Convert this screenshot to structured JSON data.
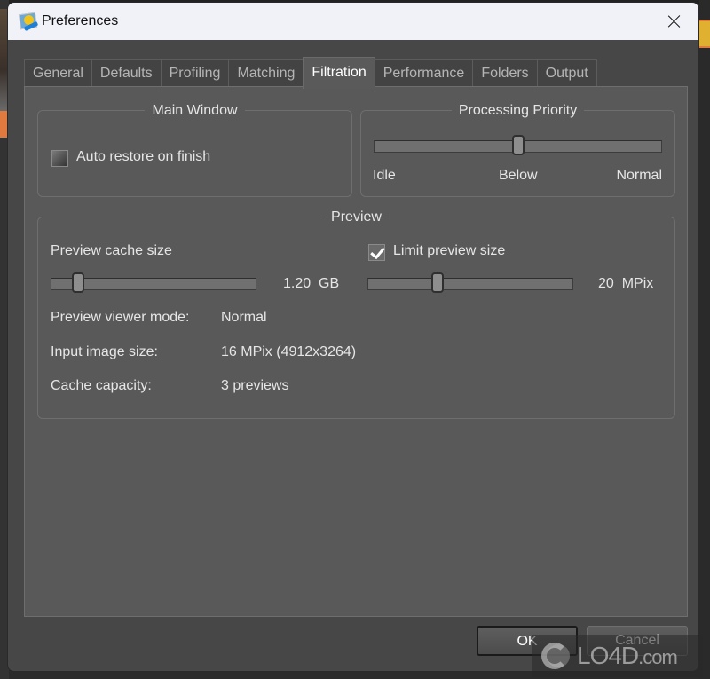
{
  "window": {
    "title": "Preferences",
    "app_icon": "image-editor-app-icon",
    "close_icon": "close-icon"
  },
  "tabs": [
    {
      "label": "General",
      "active": false
    },
    {
      "label": "Defaults",
      "active": false
    },
    {
      "label": "Profiling",
      "active": false
    },
    {
      "label": "Matching",
      "active": false
    },
    {
      "label": "Filtration",
      "active": true
    },
    {
      "label": "Performance",
      "active": false
    },
    {
      "label": "Folders",
      "active": false
    },
    {
      "label": "Output",
      "active": false
    }
  ],
  "main_window": {
    "title": "Main Window",
    "auto_restore": {
      "label": "Auto restore on finish",
      "checked": false
    }
  },
  "processing_priority": {
    "title": "Processing Priority",
    "labels": [
      "Idle",
      "Below",
      "Normal"
    ],
    "selected": "Below",
    "slider_fraction": 0.5
  },
  "preview": {
    "title": "Preview",
    "cache_size": {
      "label": "Preview cache size",
      "value": "1.20",
      "unit": "GB",
      "slider_fraction": 0.13
    },
    "limit_preview": {
      "label": "Limit preview size",
      "checked": true,
      "value": "20",
      "unit": "MPix",
      "slider_fraction": 0.34
    },
    "info": [
      {
        "label": "Preview viewer mode:",
        "value": "Normal"
      },
      {
        "label": "Input image size:",
        "value": "16 MPix (4912x3264)"
      },
      {
        "label": "Cache capacity:",
        "value": "3 previews"
      }
    ]
  },
  "buttons": {
    "ok": "OK",
    "cancel": "Cancel"
  },
  "watermark": {
    "text": "LO4D",
    "suffix": ".com"
  }
}
